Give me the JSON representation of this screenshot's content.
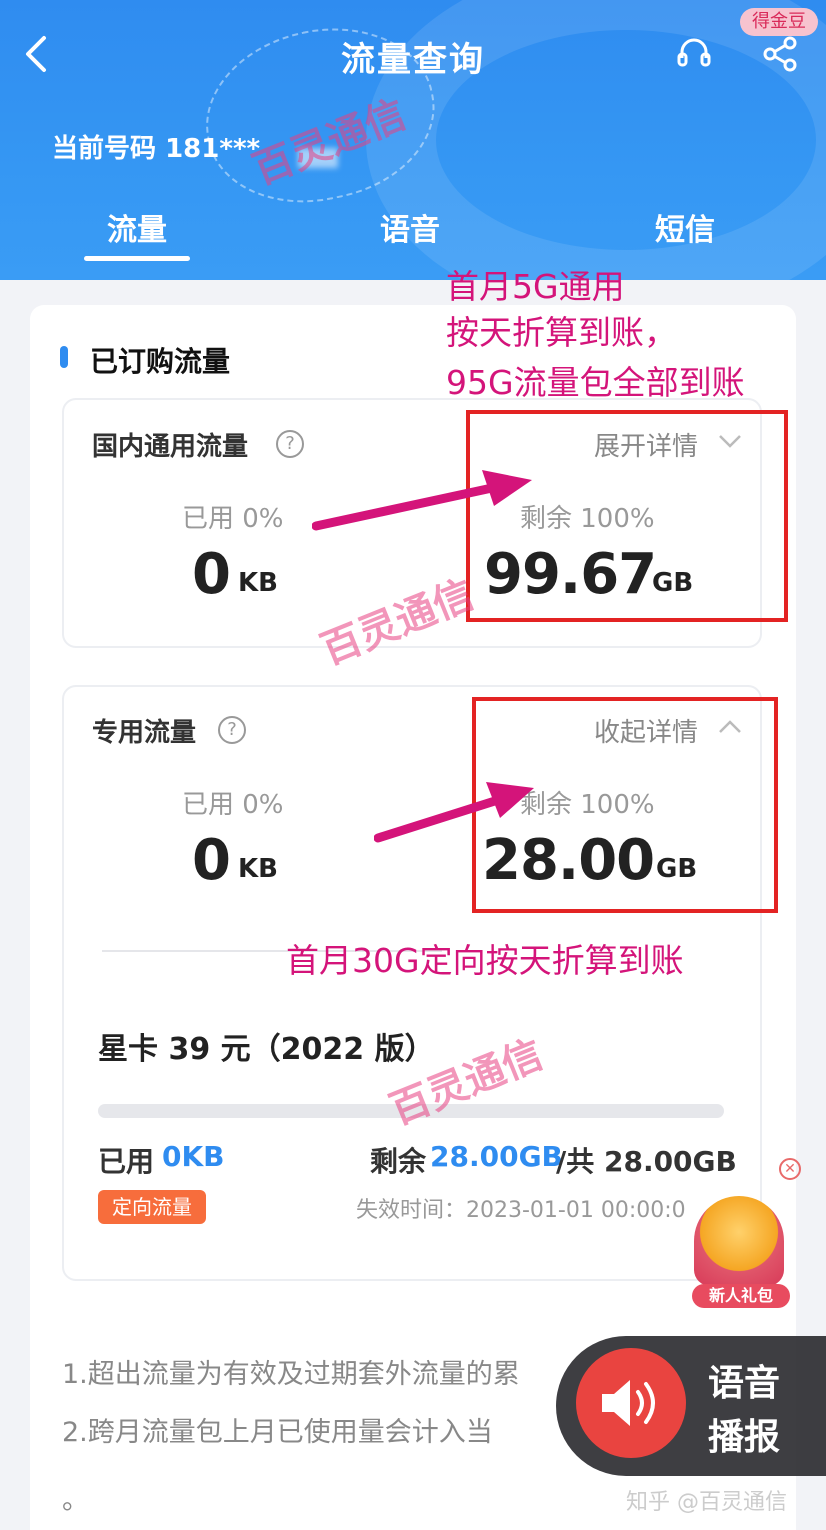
{
  "header": {
    "title": "流量查询",
    "gold_badge": "得金豆",
    "phone_label": "当前号码",
    "phone_number": "181***"
  },
  "tabs": [
    {
      "label": "流量",
      "active": true
    },
    {
      "label": "语音",
      "active": false
    },
    {
      "label": "短信",
      "active": false
    }
  ],
  "section": {
    "title": "已订购流量"
  },
  "domestic": {
    "label": "国内通用流量",
    "toggle": "展开详情",
    "used_label": "已用 0%",
    "used_value": "0",
    "used_unit": "KB",
    "remain_label": "剩余 100%",
    "remain_value": "99.67",
    "remain_unit": "GB"
  },
  "dedicated": {
    "label": "专用流量",
    "toggle": "收起详情",
    "used_label": "已用 0%",
    "used_value": "0",
    "used_unit": "KB",
    "remain_label": "剩余 100%",
    "remain_value": "28.00",
    "remain_unit": "GB"
  },
  "package": {
    "name": "星卡 39 元（2022 版）",
    "used_label": "已用",
    "used_value": "0KB",
    "remain_label": "剩余",
    "remain_value": "28.00GB",
    "total": "/共 28.00GB",
    "tag": "定向流量",
    "expire": "失效时间：2023-01-01 00:00:0",
    "progress": 0
  },
  "notes": [
    "1.超出流量为有效及过期套外流量的累",
    "2.跨月流量包上月已使用量会计入当",
    "。"
  ],
  "annotations": {
    "line1": "首月5G通用",
    "line2": "按天折算到账，",
    "line3": "95G流量包全部到账",
    "line4": "首月30G定向按天折算到账"
  },
  "watermark": "百灵通信",
  "gift": {
    "label": "新人礼包"
  },
  "voice": {
    "line1": "语音",
    "line2": "播报"
  },
  "credit": "知乎 @百灵通信",
  "colors": {
    "header_blue": "#2f8cf0",
    "accent_blue": "#2f8cf0",
    "annotation_magenta": "#d4147a",
    "box_red": "#e32323",
    "tag_orange": "#f76d3c"
  }
}
